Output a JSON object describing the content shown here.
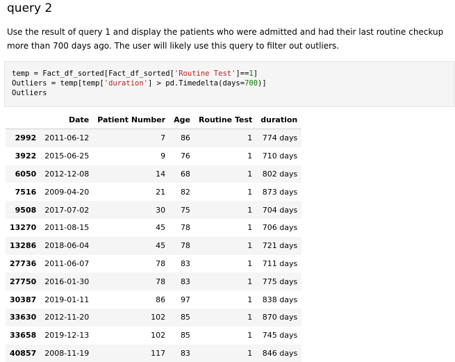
{
  "heading": "query 2",
  "description": "Use the result of query 1 and display the patients who were admitted and had their last routine checkup more than 700 days ago. The user will likely use this query to filter out outliers.",
  "code": {
    "line1_a": "temp = Fact_df_sorted[Fact_df_sorted[",
    "line1_str": "'Routine Test'",
    "line1_b": "]==",
    "line1_num": "1",
    "line1_c": "]",
    "line2_a": "Outliers = temp[temp[",
    "line2_str": "'duration'",
    "line2_b": "] > pd.Timedelta(days=",
    "line2_num": "700",
    "line2_c": ")]",
    "line3": "Outliers"
  },
  "table": {
    "columns": [
      "",
      "Date",
      "Patient Number",
      "Age",
      "Routine Test",
      "duration"
    ],
    "rows": [
      [
        "2992",
        "2011-06-12",
        "7",
        "86",
        "1",
        "774 days"
      ],
      [
        "3922",
        "2015-06-25",
        "9",
        "76",
        "1",
        "710 days"
      ],
      [
        "6050",
        "2012-12-08",
        "14",
        "68",
        "1",
        "802 days"
      ],
      [
        "7516",
        "2009-04-20",
        "21",
        "82",
        "1",
        "873 days"
      ],
      [
        "9508",
        "2017-07-02",
        "30",
        "75",
        "1",
        "704 days"
      ],
      [
        "13270",
        "2011-08-15",
        "45",
        "78",
        "1",
        "706 days"
      ],
      [
        "13286",
        "2018-06-04",
        "45",
        "78",
        "1",
        "721 days"
      ],
      [
        "27736",
        "2011-06-07",
        "78",
        "83",
        "1",
        "711 days"
      ],
      [
        "27750",
        "2016-01-30",
        "78",
        "83",
        "1",
        "775 days"
      ],
      [
        "30387",
        "2019-01-11",
        "86",
        "97",
        "1",
        "838 days"
      ],
      [
        "33630",
        "2012-11-20",
        "102",
        "85",
        "1",
        "870 days"
      ],
      [
        "33658",
        "2019-12-13",
        "102",
        "85",
        "1",
        "745 days"
      ],
      [
        "40857",
        "2008-11-19",
        "117",
        "83",
        "1",
        "846 days"
      ]
    ]
  }
}
